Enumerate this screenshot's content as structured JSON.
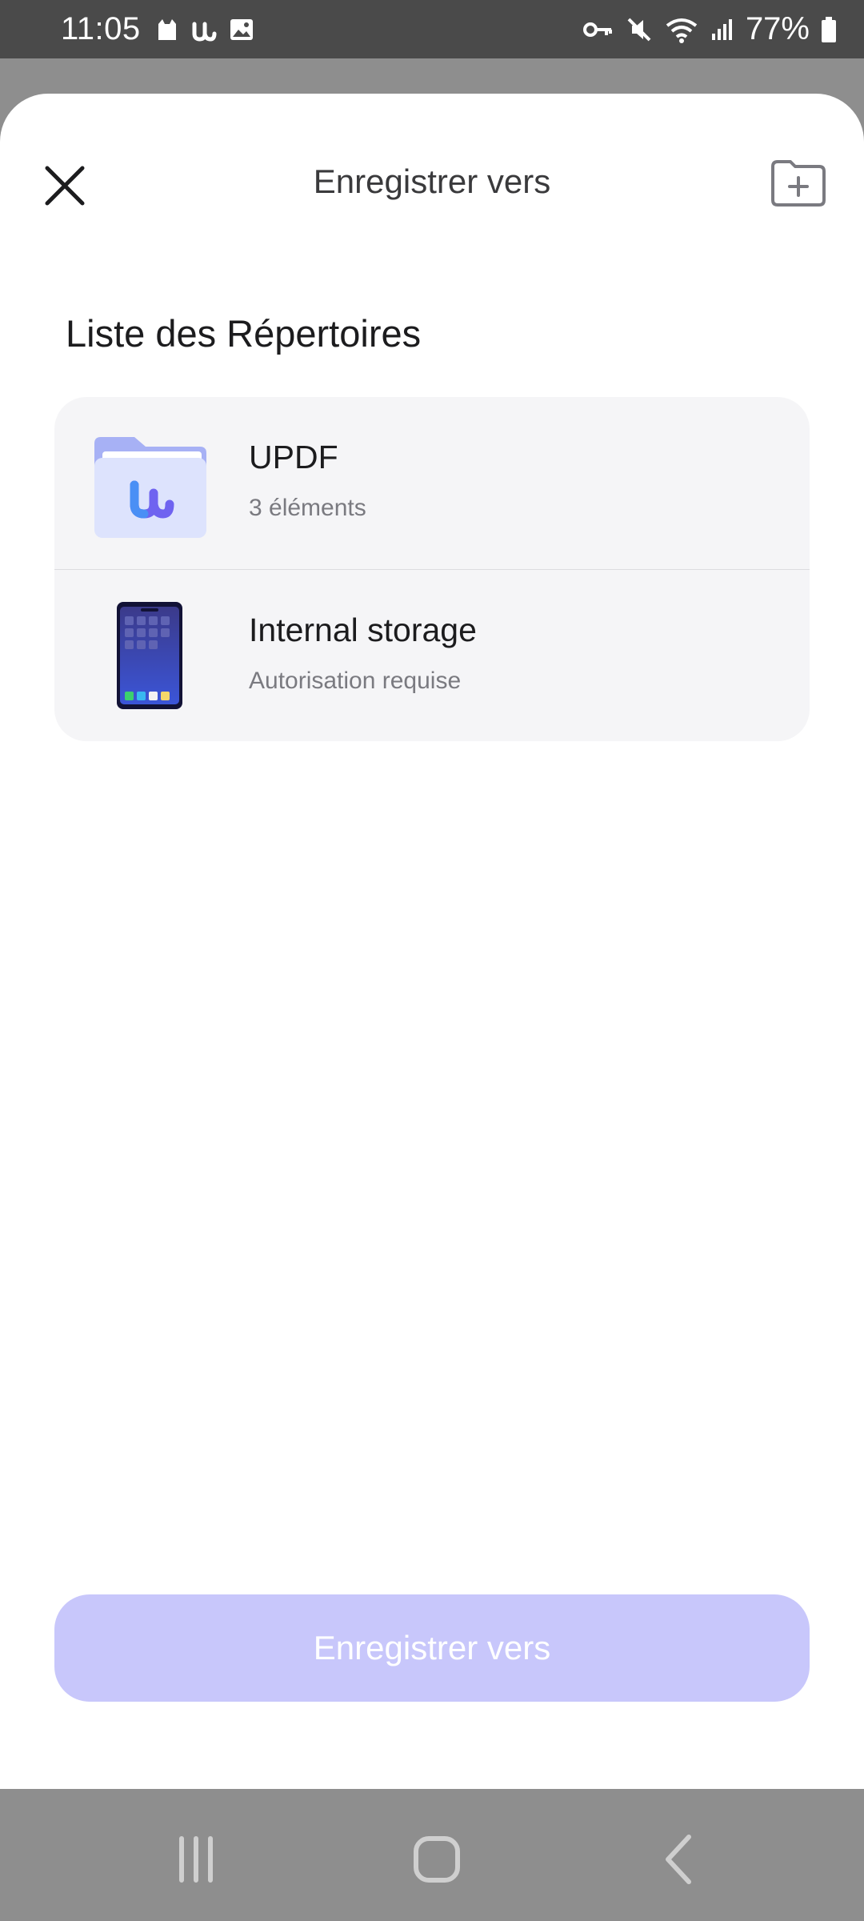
{
  "status_bar": {
    "time": "11:05",
    "battery_percent": "77%",
    "left_icons": [
      "cat-icon",
      "updf-icon",
      "image-icon"
    ],
    "right_icons": [
      "vpn-key-icon",
      "mute-icon",
      "wifi-icon",
      "signal-icon",
      "battery-icon"
    ]
  },
  "sheet": {
    "title": "Enregistrer vers",
    "close_icon": "close-icon",
    "new_folder_icon": "new-folder-icon",
    "section_title": "Liste des Répertoires",
    "items": [
      {
        "title": "UPDF",
        "subtitle": "3 éléments",
        "icon": "folder-icon"
      },
      {
        "title": "Internal storage",
        "subtitle": "Autorisation requise",
        "icon": "phone-icon"
      }
    ],
    "save_button_label": "Enregistrer vers"
  },
  "nav_bar": {
    "recent_icon": "recent-apps-icon",
    "home_icon": "home-icon",
    "back_icon": "back-icon"
  },
  "colors": {
    "accent_disabled": "#c8c7fb",
    "status_bar": "#4a4a4a",
    "card": "#f5f5f7"
  }
}
